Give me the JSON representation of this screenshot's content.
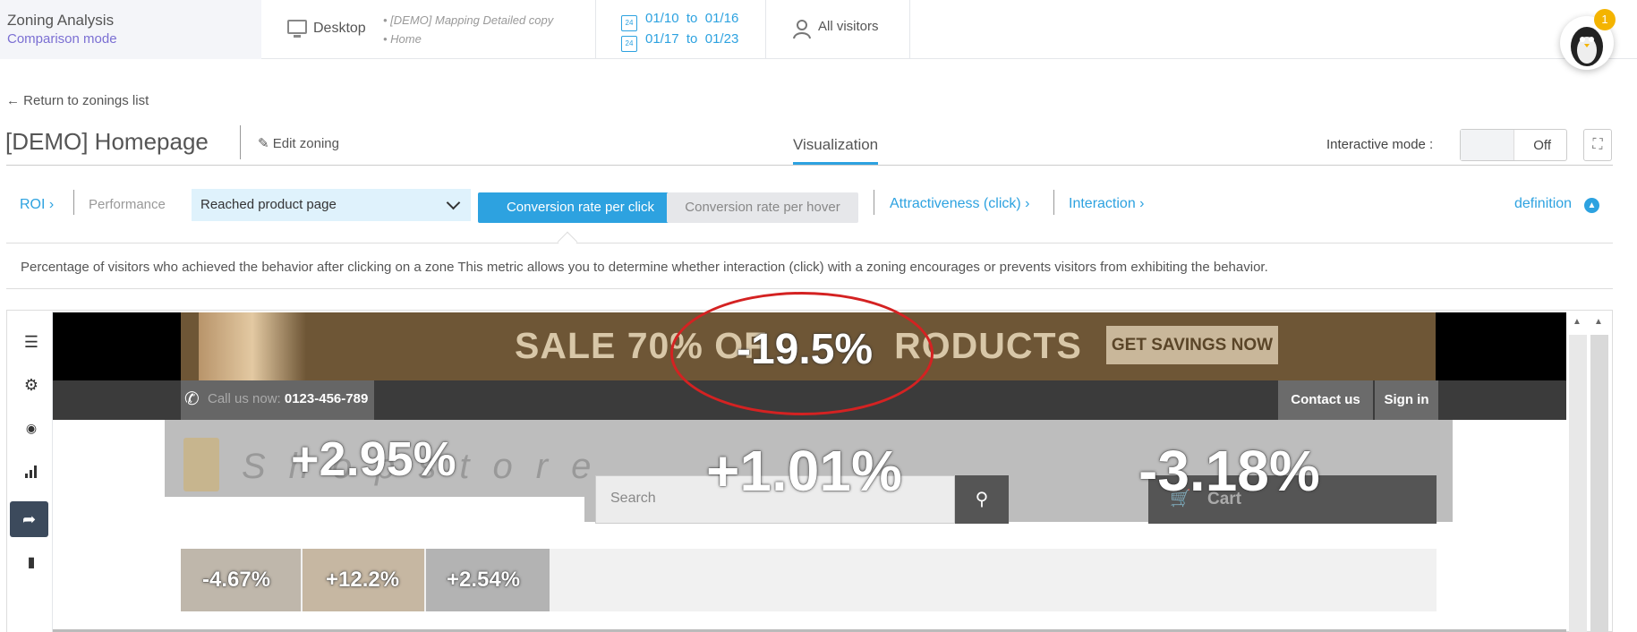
{
  "app": {
    "title": "Zoning Analysis",
    "mode": "Comparison mode"
  },
  "header": {
    "device": "Desktop",
    "pages": [
      "• [DEMO] Mapping Detailed copy",
      "• Home"
    ],
    "date_icon": "24",
    "dates": [
      {
        "from": "01/10",
        "to_word": "to",
        "to": "01/16"
      },
      {
        "from": "01/17",
        "to_word": "to",
        "to": "01/23"
      }
    ],
    "visitors": "All visitors",
    "notification_count": "1"
  },
  "toolbar": {
    "back": "Return to zonings list",
    "page_title": "[DEMO] Homepage",
    "edit": "Edit zoning",
    "tab": "Visualization",
    "interactive_label": "Interactive mode :",
    "interactive_state": "Off"
  },
  "metrics": {
    "roi": "ROI",
    "performance": "Performance",
    "goal_selected": "Reached product page",
    "btn_click": "Conversion rate per click",
    "btn_hover": "Conversion rate per hover",
    "attractiveness": "Attractiveness (click)",
    "interaction": "Interaction",
    "definition": "definition",
    "description": "Percentage of visitors who achieved the behavior after clicking on a zone This metric allows you to determine whether interaction (click) with a zoning encourages or prevents visitors from exhibiting the behavior."
  },
  "site": {
    "banner_text": "SALE 70% OF",
    "banner_text_tail": "RODUCTS",
    "banner_cta": "GET SAVINGS NOW",
    "call_label": "Call us now:",
    "call_number": "0123-456-789",
    "contact": "Contact us",
    "signin": "Sign in",
    "logo": "Shopstore",
    "search_placeholder": "Search",
    "cart": "Cart"
  },
  "zones": {
    "banner": "-19.5%",
    "logo": "+2.95%",
    "search": "+1.01%",
    "cart": "-3.18%",
    "menu1": "-4.67%",
    "menu2": "+12.2%",
    "menu3": "+2.54%"
  },
  "colors": {
    "accent": "#2da2e0",
    "highlight": "#d42222",
    "mode": "#7b6fd3"
  }
}
